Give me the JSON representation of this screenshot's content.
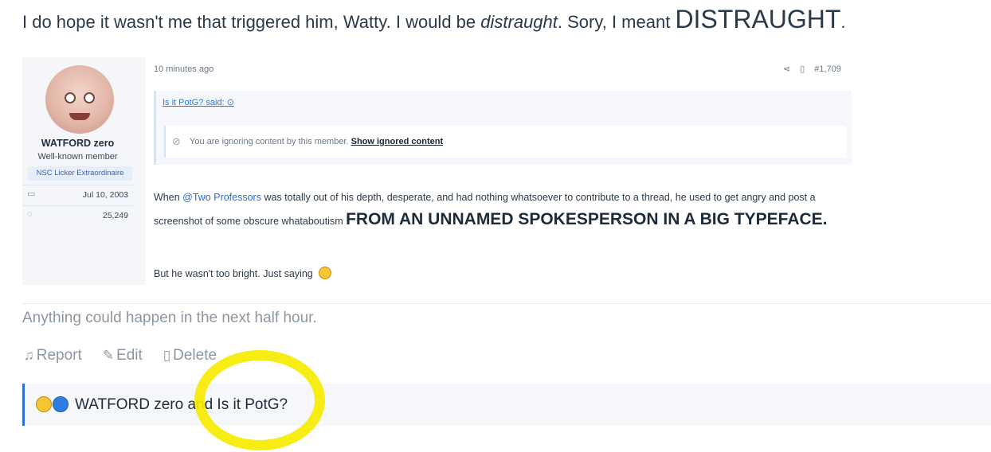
{
  "top_text": {
    "part1": "I do hope it wasn't me that triggered him, Watty. I would be ",
    "em": "distraught",
    "part2": ". Sory, I meant ",
    "big": "DISTRAUGHT",
    "end": "."
  },
  "quoted_post": {
    "user": {
      "name": "WATFORD zero",
      "title": "Well-known member",
      "banner": "NSC Licker Extraordinaire",
      "joined": "Jul 10, 2003",
      "messages": "25,249"
    },
    "time": "10 minutes ago",
    "post_number": "#1,709",
    "quote": {
      "header": "Is it PotG? said:",
      "ignored_text": "You are ignoring content by this member.",
      "show_ignored": "Show ignored content"
    },
    "body": {
      "p1_a": "When ",
      "mention": "@Two Professors",
      "p1_b": " was totally out of his depth, desperate, and had nothing whatsoever to contribute to a thread, he used to get angry and post a screenshot of some obscure whataboutism ",
      "p1_big": "FROM AN UNNAMED SPOKESPERSON IN A BIG TYPEFACE.",
      "p2": "But he wasn't too bright. Just saying "
    }
  },
  "signature": "Anything could happen in the next half hour.",
  "actions": {
    "report": "Report",
    "edit": "Edit",
    "delete": "Delete"
  },
  "reactions": {
    "text": "WATFORD zero and Is it PotG?",
    "icons": [
      "laugh-emoji-icon",
      "like-icon"
    ]
  },
  "colors": {
    "highlight": "#f6ea00",
    "accent": "#2f6ed8",
    "mention": "#2b6dd6"
  }
}
